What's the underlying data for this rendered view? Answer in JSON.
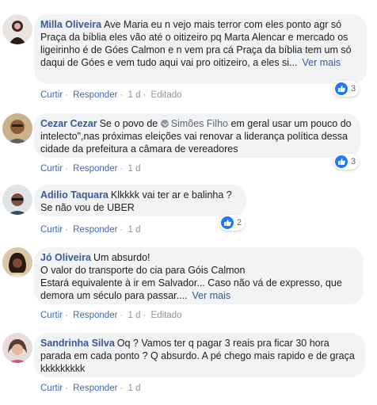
{
  "comments": [
    {
      "author": "Milla Oliveira",
      "text": "Ave Maria eu n vejo mais terror com eles ponto agr só Praça da bíblia eles vão até o oitizeiro pq Marta Alencar e mercado os ligeirinho é de Góes Calmon e n vem pra cá Praça da bíblia tem um só daqui de Góes e vem tudo aqui vai pro oitizeiro, a eles si...",
      "more": "Ver mais",
      "reactions": "3",
      "reply_like": "Curtir",
      "reply": "Responder",
      "time": "1 d",
      "edited": "Editado"
    },
    {
      "author": "Cezar Cezar",
      "text_before": "Se o povo de",
      "mention": "Simões Filho",
      "text_after": "em geral usar um pouco do intelecto\",nas próximas eleições vai renovar a liderança política dessa cidade da prefeitura a câmara de vereadores",
      "reactions": "3",
      "reply_like": "Curtir",
      "reply": "Responder",
      "time": "1 d"
    },
    {
      "author": "Adilio Taquara",
      "text": "Klkkkk vai ter ar e balinha ?\nSe não vou de UBER",
      "reactions": "2",
      "reply_like": "Curtir",
      "reply": "Responder",
      "time": "1 d"
    },
    {
      "author": "Jó Oliveira",
      "text": "Um absurdo!\nO valor do transporte do cia para Góis Calmon\nEstará equivalente à ir em Salvador... Caso não vá de expresso, que demora um século para passar....",
      "more": "Ver mais",
      "reply_like": "Curtir",
      "reply": "Responder",
      "time": "1 d",
      "edited": "Editado"
    },
    {
      "author": "Sandrinha Silva",
      "text": "Oq ? Vamos ter q pagar 3 reais pra ficar 30 hora parada em cada ponto ? Q absurdo. A pé chego mais rapido e de graça kkkkkkkkk",
      "reply_like": "Curtir",
      "reply": "Responder",
      "time": "1 d"
    }
  ],
  "icons": {
    "reaction": "like-icon",
    "mention": "place-icon"
  },
  "colors": {
    "author": "#385898",
    "bubble": "#f2f3f5",
    "like": "#2078f4",
    "action": "#4267b2",
    "meta": "#90949c"
  }
}
